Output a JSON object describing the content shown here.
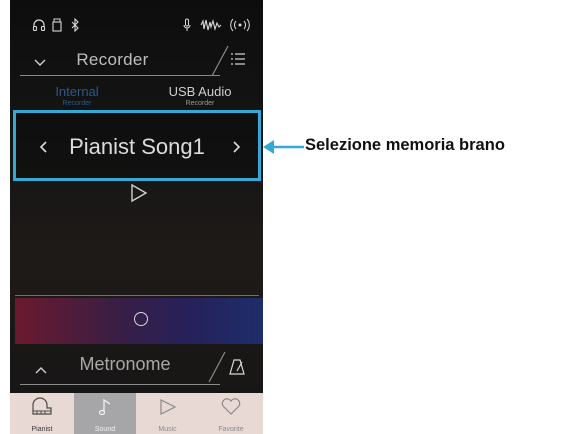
{
  "recorder": {
    "title": "Recorder",
    "tabs": [
      {
        "label": "Internal",
        "sublabel": "Recorder",
        "active": true
      },
      {
        "label": "USB Audio",
        "sublabel": "Recorder",
        "active": false
      }
    ],
    "song_name": "Pianist Song1"
  },
  "metronome": {
    "title": "Metronome"
  },
  "bottom_nav": [
    {
      "label": "Pianist",
      "icon": "piano-icon",
      "selected": false
    },
    {
      "label": "Sound",
      "icon": "music-note-icon",
      "selected": true
    },
    {
      "label": "Music",
      "icon": "play-icon",
      "selected": false
    },
    {
      "label": "Favorite",
      "icon": "heart-icon",
      "selected": false
    }
  ],
  "annotation": {
    "text": "Selezione memoria brano"
  },
  "colors": {
    "highlight": "#35a8d6",
    "active_tab": "#2a5a88"
  }
}
